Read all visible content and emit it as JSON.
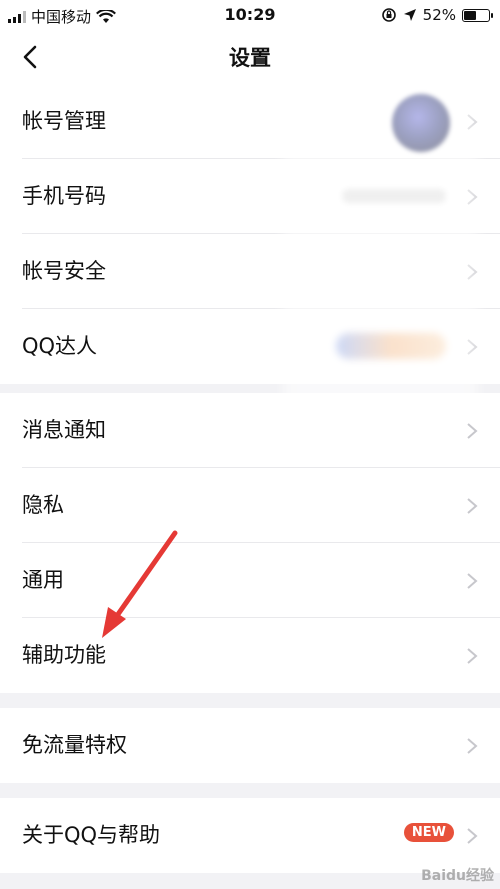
{
  "status_bar": {
    "carrier": "中国移动",
    "time": "10:29",
    "battery": "52%",
    "battery_level": 0.52,
    "icons": [
      "signal-icon",
      "wifi-icon",
      "orientation-lock-icon",
      "location-icon",
      "battery-icon"
    ]
  },
  "nav": {
    "title": "设置",
    "back_icon": "back-chevron-icon"
  },
  "groups": [
    {
      "items": [
        {
          "label": "帐号管理"
        },
        {
          "label": "手机号码"
        },
        {
          "label": "帐号安全"
        },
        {
          "label": "QQ达人"
        }
      ]
    },
    {
      "items": [
        {
          "label": "消息通知"
        },
        {
          "label": "隐私"
        },
        {
          "label": "通用"
        },
        {
          "label": "辅助功能"
        }
      ]
    },
    {
      "items": [
        {
          "label": "免流量特权"
        }
      ]
    },
    {
      "items": [
        {
          "label": "关于QQ与帮助",
          "badge": "NEW"
        }
      ]
    }
  ],
  "watermark": "Baidu经验",
  "colors": {
    "background": "#f2f2f5",
    "badge": "#e8513a",
    "annotation_arrow": "#e53935"
  }
}
